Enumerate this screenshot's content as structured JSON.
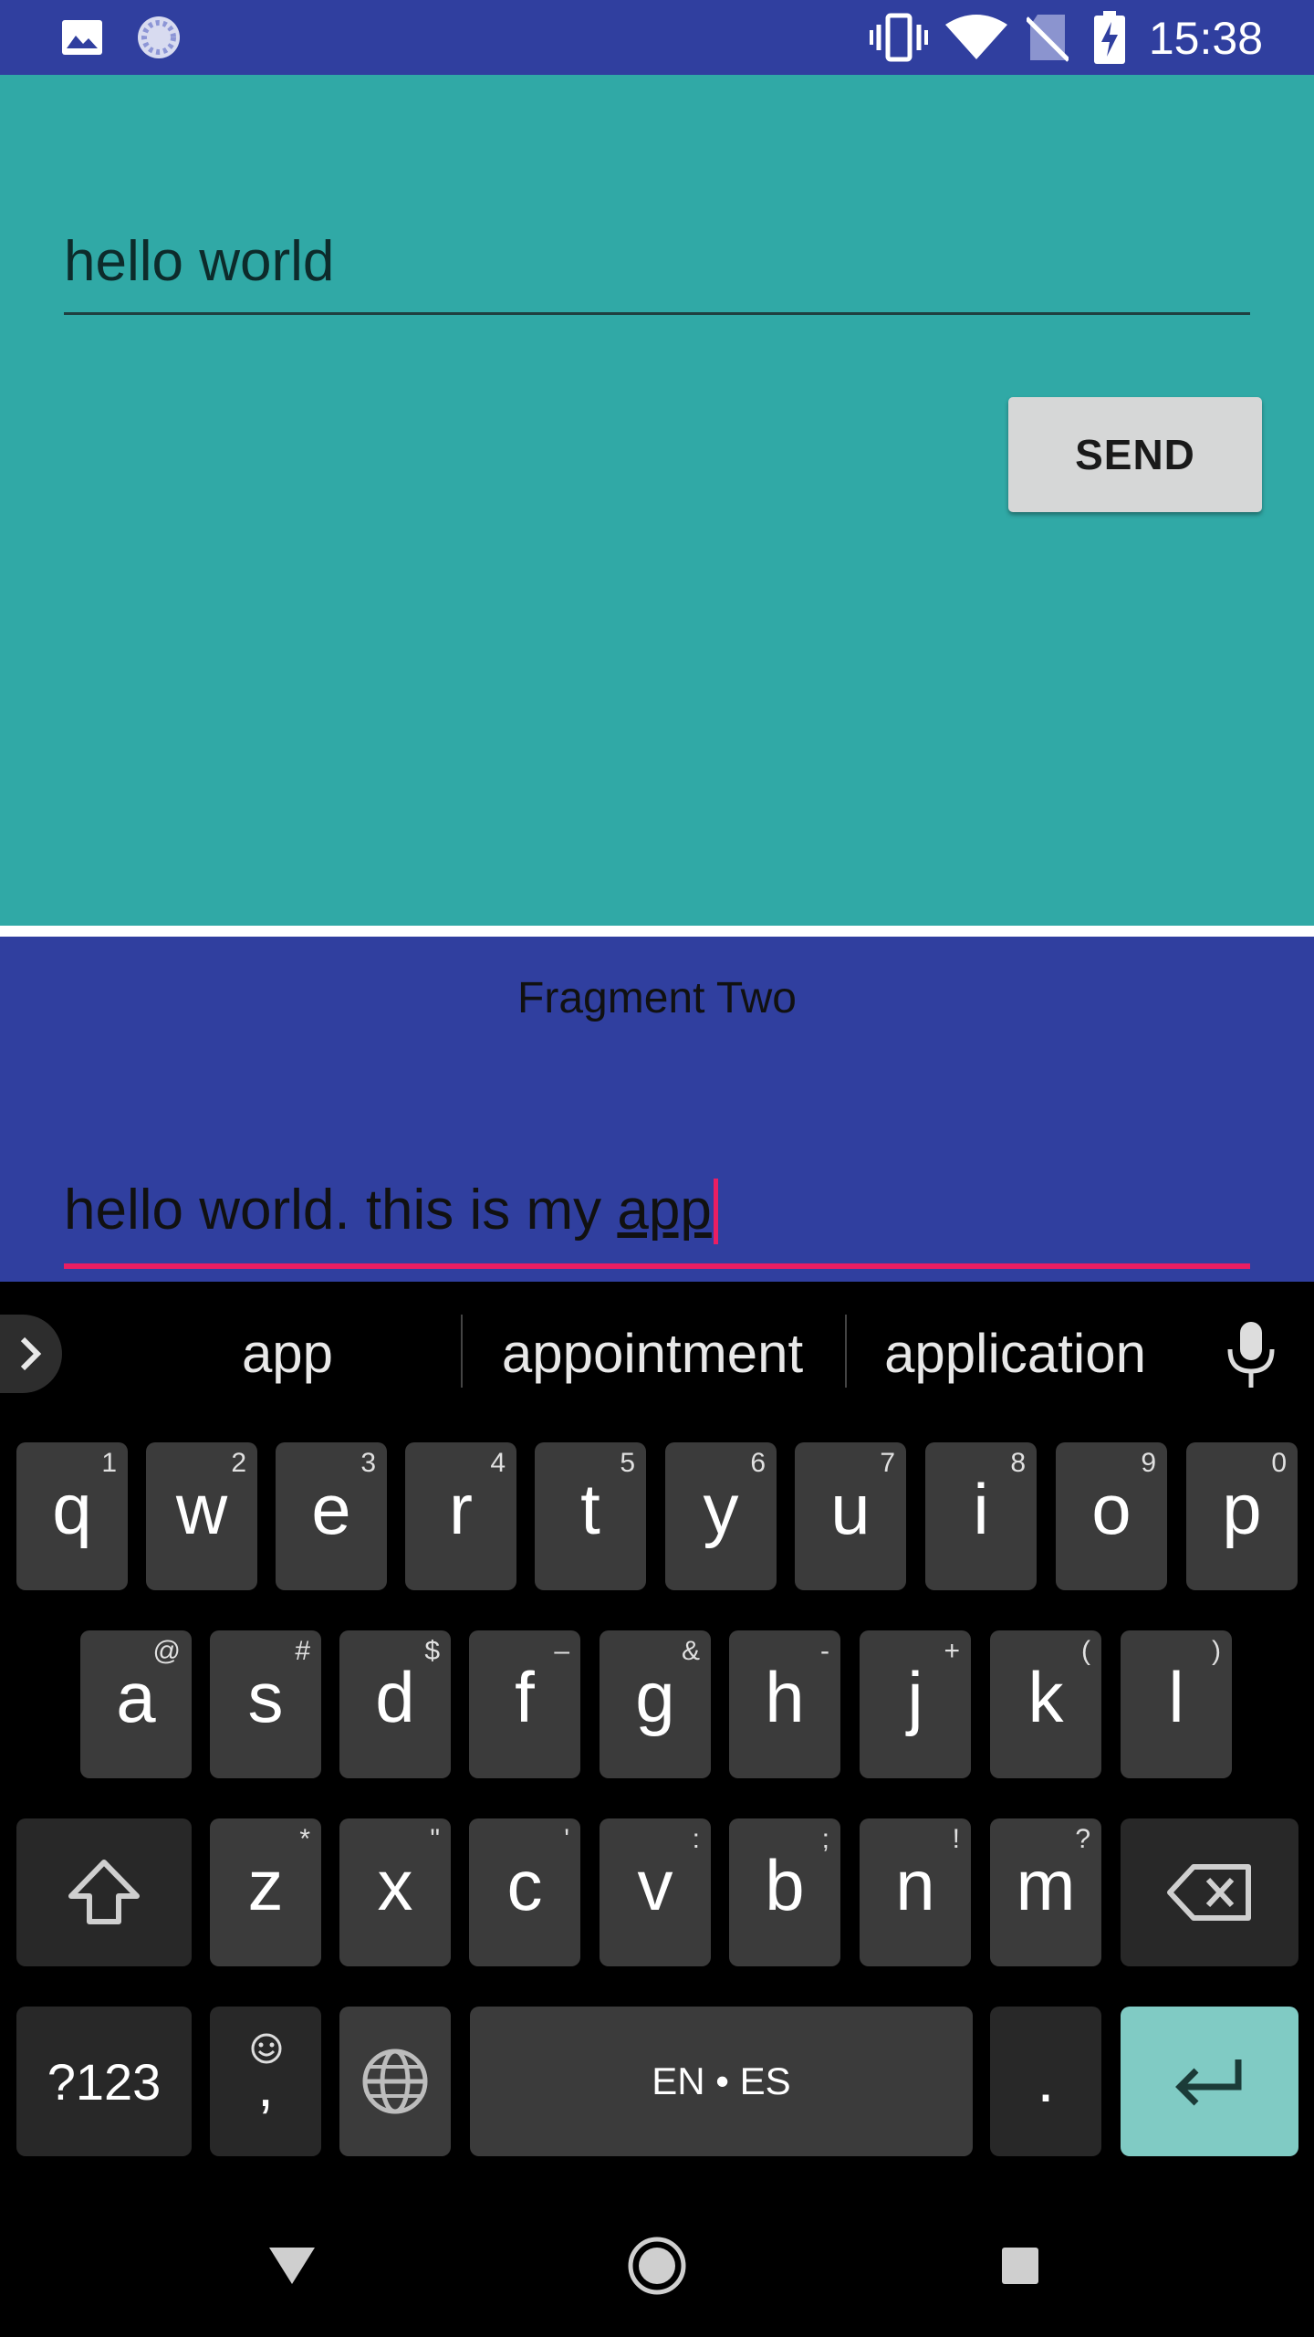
{
  "status_bar": {
    "time": "15:38",
    "left_icons": [
      "image-icon",
      "loading-icon"
    ],
    "right_icons": [
      "vibrate-icon",
      "wifi-icon",
      "no-sim-icon",
      "battery-charging-icon"
    ],
    "color": "#303F9F"
  },
  "fragment_one": {
    "input_value": "hello world",
    "send_label": "SEND",
    "background_color": "#30A9A6"
  },
  "fragment_two": {
    "title": "Fragment Two",
    "input_prefix": "hello world. this is my ",
    "input_composing": "app",
    "background_color": "#303F9F",
    "accent_color": "#E91E63"
  },
  "keyboard": {
    "suggestions": [
      "app",
      "appointment",
      "application"
    ],
    "row1": [
      {
        "key": "q",
        "hint": "1"
      },
      {
        "key": "w",
        "hint": "2"
      },
      {
        "key": "e",
        "hint": "3"
      },
      {
        "key": "r",
        "hint": "4"
      },
      {
        "key": "t",
        "hint": "5"
      },
      {
        "key": "y",
        "hint": "6"
      },
      {
        "key": "u",
        "hint": "7"
      },
      {
        "key": "i",
        "hint": "8"
      },
      {
        "key": "o",
        "hint": "9"
      },
      {
        "key": "p",
        "hint": "0"
      }
    ],
    "row2": [
      {
        "key": "a",
        "hint": "@"
      },
      {
        "key": "s",
        "hint": "#"
      },
      {
        "key": "d",
        "hint": "$"
      },
      {
        "key": "f",
        "hint": "–"
      },
      {
        "key": "g",
        "hint": "&"
      },
      {
        "key": "h",
        "hint": "-"
      },
      {
        "key": "j",
        "hint": "+"
      },
      {
        "key": "k",
        "hint": "("
      },
      {
        "key": "l",
        "hint": ")"
      }
    ],
    "row3": [
      {
        "key": "z",
        "hint": "*"
      },
      {
        "key": "x",
        "hint": "\""
      },
      {
        "key": "c",
        "hint": "'"
      },
      {
        "key": "v",
        "hint": ":"
      },
      {
        "key": "b",
        "hint": ";"
      },
      {
        "key": "n",
        "hint": "!"
      },
      {
        "key": "m",
        "hint": "?"
      }
    ],
    "symbols_label": "?123",
    "emoji_comma_label": ",",
    "space_label": "EN • ES",
    "period_label": ".",
    "enter_color": "#80CBC4"
  },
  "nav_bar": {
    "buttons": [
      "back-icon",
      "home-icon",
      "recents-icon"
    ]
  }
}
